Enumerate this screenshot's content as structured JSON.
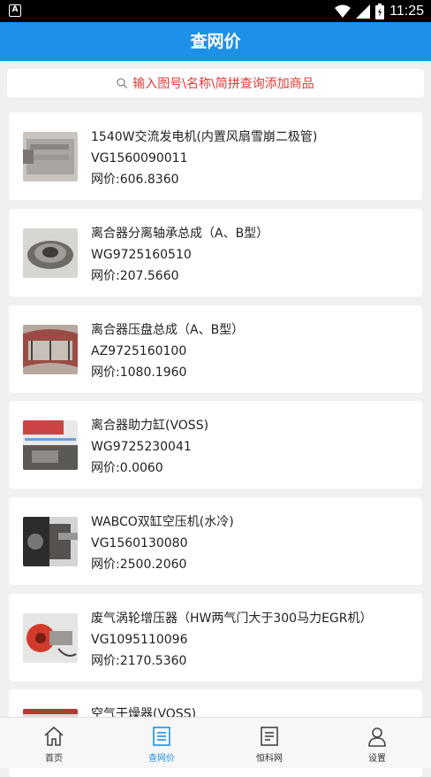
{
  "status_bar": {
    "time": "11:25"
  },
  "app_bar": {
    "title": "查网价"
  },
  "search": {
    "placeholder": "输入图号\\名称\\简拼查询添加商品"
  },
  "products": [
    {
      "name": "1540W交流发电机(内置风扇雪崩二极管)",
      "code": "VG1560090011",
      "price": "网价:606.8360",
      "thumb": "alternator-photo"
    },
    {
      "name": "离合器分离轴承总成（A、B型）",
      "code": "WG9725160510",
      "price": "网价:207.5660",
      "thumb": "bearing-photo"
    },
    {
      "name": "离合器压盘总成（A、B型）",
      "code": "AZ9725160100",
      "price": "网价:1080.1960",
      "thumb": "pressure-plate-photo"
    },
    {
      "name": "离合器助力缸(VOSS)",
      "code": "WG9725230041",
      "price": "网价:0.0060",
      "thumb": "booster-photo"
    },
    {
      "name": "WABCO双缸空压机(水冷)",
      "code": "VG1560130080",
      "price": "网价:2500.2060",
      "thumb": "compressor-photo"
    },
    {
      "name": "废气涡轮增压器（HW两气门大于300马力EGR机）",
      "code": "VG1095110096",
      "price": "网价:2170.5360",
      "thumb": "turbo-photo"
    },
    {
      "name": "空气干燥器(VOSS)",
      "code": "",
      "price": "",
      "thumb": "dryer-photo"
    }
  ],
  "bottom_nav": [
    {
      "label": "首页",
      "icon": "home-icon",
      "active": false
    },
    {
      "label": "查网价",
      "icon": "list-icon",
      "active": true
    },
    {
      "label": "恒科网",
      "icon": "document-icon",
      "active": false
    },
    {
      "label": "设置",
      "icon": "user-icon",
      "active": false
    }
  ],
  "colors": {
    "accent": "#1e90e8",
    "search_text": "#e53935"
  }
}
